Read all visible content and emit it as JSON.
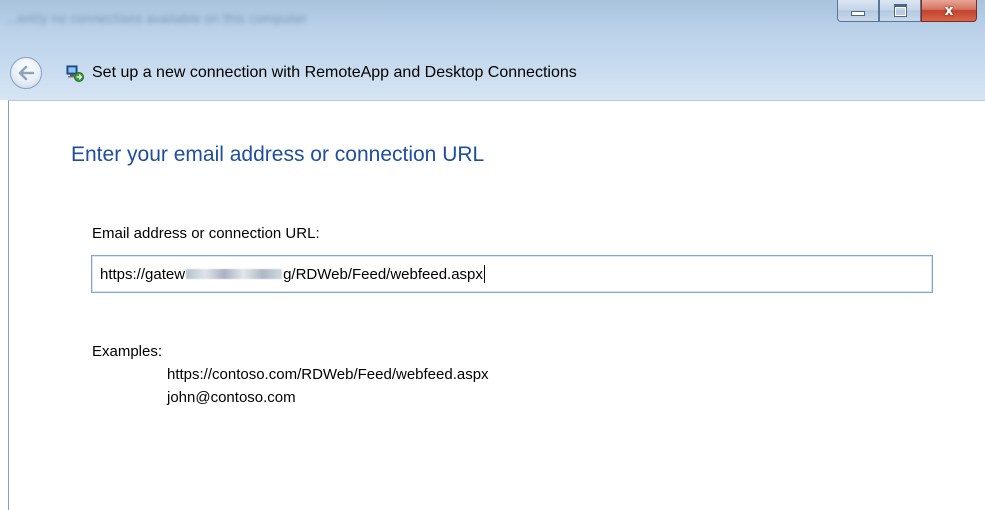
{
  "window": {
    "background_title": "...ently no connections available on this computer",
    "title": "Set up a new connection with RemoteApp and Desktop Connections",
    "close_symbol": "x",
    "accent_color": "#1e4e9f"
  },
  "icons": {
    "back": "back-arrow-icon",
    "app": "remoteapp-connection-icon",
    "minimize": "minimize-icon",
    "maximize": "maximize-icon",
    "close": "close-icon"
  },
  "main": {
    "heading": "Enter your email address or connection URL",
    "field_label": "Email address or connection URL:",
    "field_value_prefix": "https://gatew",
    "field_value_suffix": "g/RDWeb/Feed/webfeed.aspx",
    "examples_label": "Examples:",
    "examples": [
      "https://contoso.com/RDWeb/Feed/webfeed.aspx",
      "john@contoso.com"
    ]
  }
}
